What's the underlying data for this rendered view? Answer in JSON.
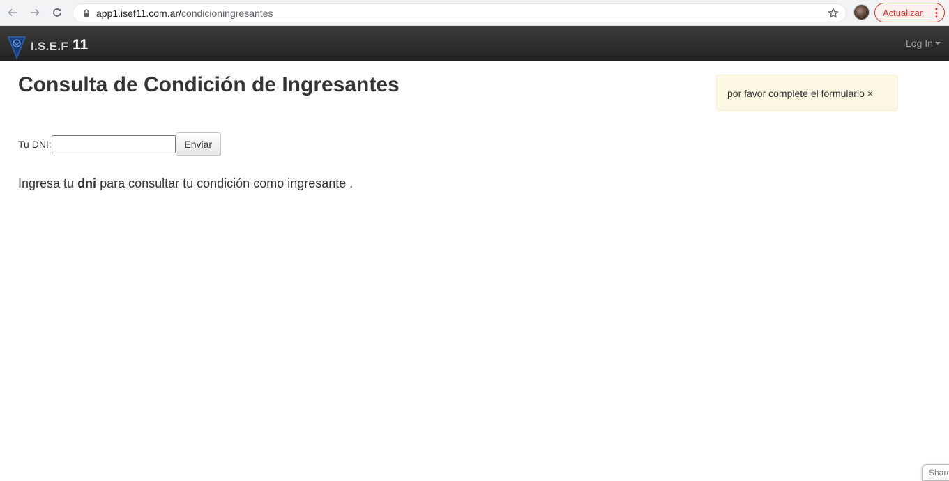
{
  "browser": {
    "url_domain": "app1.isef11.com.ar/",
    "url_path": "condicioningresantes",
    "update_label": "Actualizar"
  },
  "navbar": {
    "brand": "I.S.E.F",
    "brand_number": "11",
    "login_label": "Log In"
  },
  "page": {
    "title": "Consulta de Condición de Ingresantes",
    "alert_text": "por favor complete el formulario",
    "alert_close": "×",
    "dni_label": "Tu DNI:",
    "dni_value": "",
    "send_label": "Enviar",
    "info_before": "Ingresa tu ",
    "info_bold": "dni",
    "info_after": " para consultar tu condición como ingresante ."
  },
  "footer": {
    "share_label": "Share"
  }
}
